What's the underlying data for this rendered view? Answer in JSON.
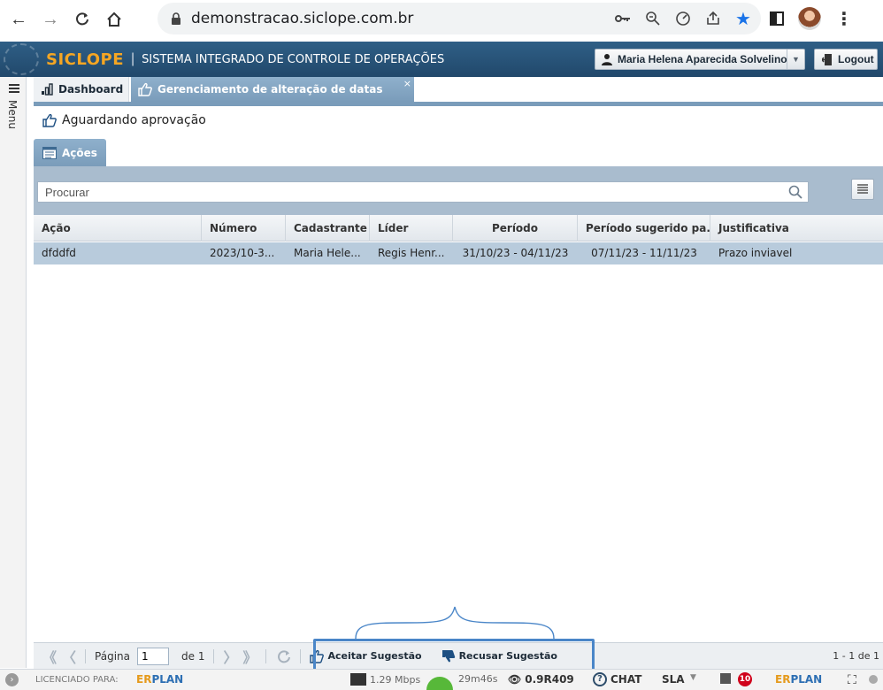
{
  "browser": {
    "url": "demonstracao.siclope.com.br"
  },
  "header": {
    "logo": "SICLOPE",
    "separator": "|",
    "system_name": "SISTEMA INTEGRADO DE CONTROLE DE OPERAÇÕES",
    "user_name": "Maria Helena Aparecida Solvelino",
    "logout_label": "Logout"
  },
  "side_menu": {
    "label": "Menu"
  },
  "tabs": [
    {
      "label": "Dashboard"
    },
    {
      "label": "Gerenciamento de alteração de datas",
      "close": "×"
    }
  ],
  "section": {
    "title": "Aguardando aprovação"
  },
  "panel": {
    "tab_label": "Ações",
    "search_placeholder": "Procurar"
  },
  "grid": {
    "columns": [
      "Ação",
      "Número",
      "Cadastrante",
      "Líder",
      "Período",
      "Período sugerido pa...",
      "Justificativa"
    ],
    "rows": [
      [
        "dfddfd",
        "2023/10-3...",
        "Maria Hele...",
        "Regis Henr...",
        "31/10/23 - 04/11/23",
        "07/11/23 - 11/11/23",
        "Prazo inviavel"
      ]
    ]
  },
  "paging": {
    "page_label": "Página",
    "page_value": "1",
    "of_label": "de 1",
    "accept_label": "Aceitar Sugestão",
    "reject_label": "Recusar Sugestão",
    "count_label": "1 - 1 de 1"
  },
  "statusbar": {
    "licensed_label": "LICENCIADO PARA:",
    "brand_a": "ER",
    "brand_b": "PLAN",
    "speed": "1.29 Mbps",
    "timer": "29m46s",
    "version": "0.9R409",
    "chat_label": "CHAT",
    "sla_label": "SLA",
    "badge_count": "10"
  },
  "colors": {
    "header_bg": "#21486b",
    "tab_active": "#7a9cba",
    "row_selected": "#b8cbdc",
    "highlight": "#4a86c8",
    "logo": "#f5a623"
  }
}
